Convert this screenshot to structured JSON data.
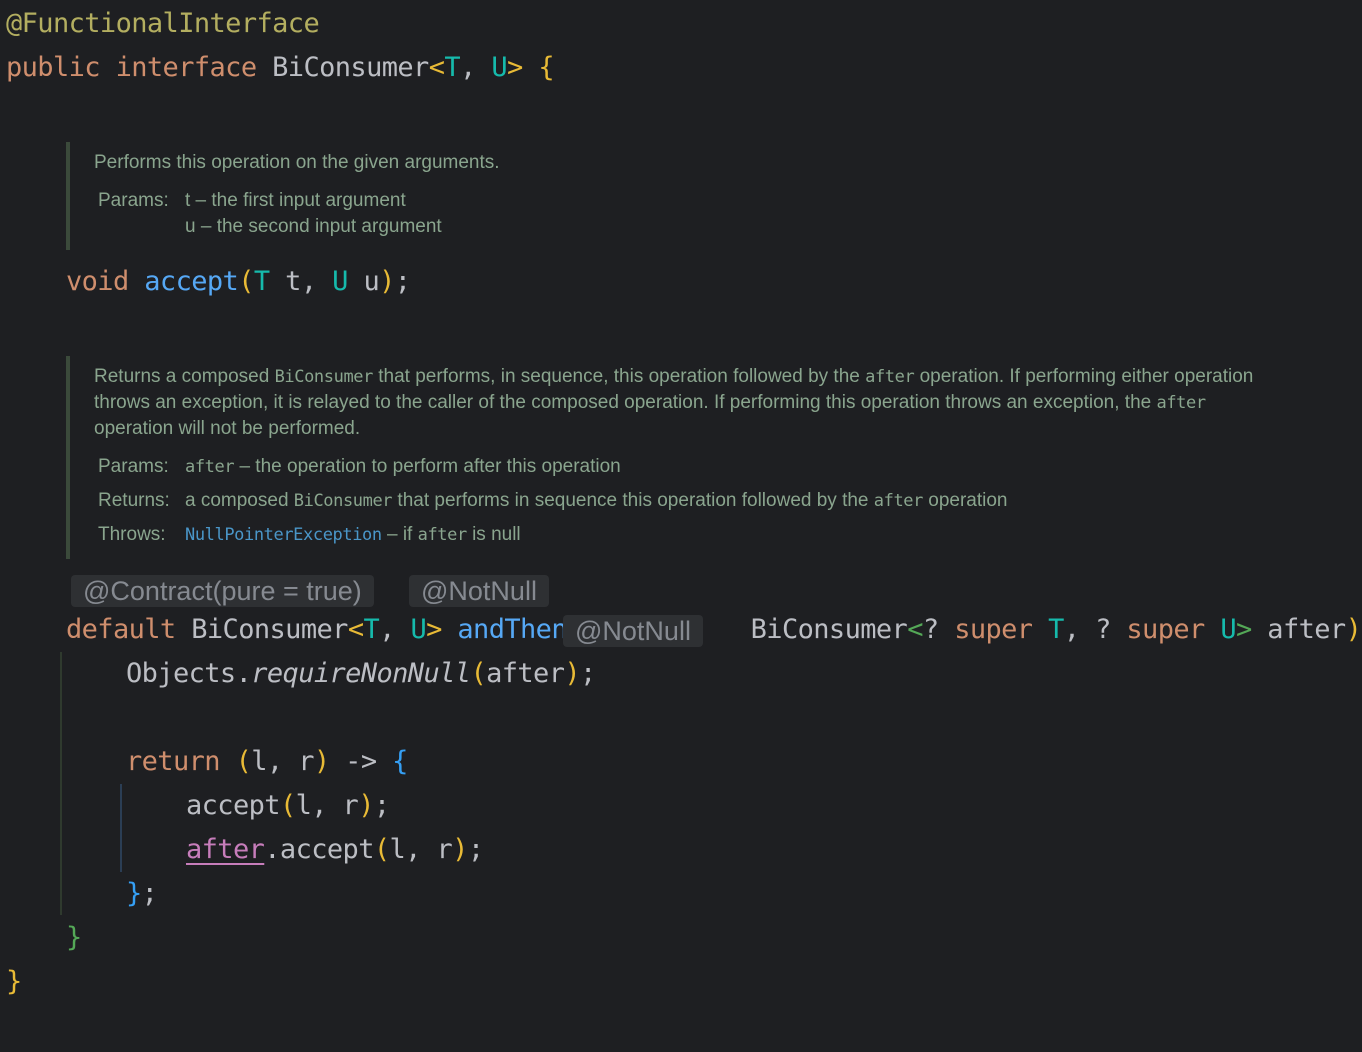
{
  "code": {
    "l1": {
      "annotation": "@FunctionalInterface"
    },
    "l2": {
      "public": "public",
      "interface": "interface",
      "name": "BiConsumer",
      "lt": "<",
      "t": "T",
      "comma": ", ",
      "u": "U",
      "gt": ">",
      "sp": " ",
      "brace": "{"
    },
    "accept_line": {
      "void": "void",
      "sp1": " ",
      "name": "accept",
      "lp": "(",
      "t": "T",
      "t_param": " t, ",
      "u": "U",
      "u_param": " u",
      "rp": ")",
      "semi": ";"
    },
    "andthen_line": {
      "default": "default",
      "ret_type": " BiConsumer",
      "lt": "<",
      "t": "T",
      "comma": ", ",
      "u": "U",
      "gt": ">",
      "sp": " ",
      "name": "andThen",
      "lp": "(",
      "param_type": "BiConsumer",
      "lt2": "<",
      "q1": "? ",
      "super1": "super",
      "sp1": " ",
      "t2": "T",
      "comma2": ", ",
      "q2": "? ",
      "super2": "super",
      "sp2": " ",
      "u2": "U",
      "gt2": ">",
      "param_name": " after",
      "rp": ")",
      "sp3": " ",
      "brace": "{"
    },
    "require_line": {
      "obj": "Objects.",
      "method": "requireNonNull",
      "lp": "(",
      "arg": "after",
      "rp": ")",
      "semi": ";"
    },
    "return_line": {
      "ret": "return",
      "sp": " ",
      "lp": "(",
      "params": "l, r",
      "rp": ")",
      "arrow": " -> ",
      "brace": "{"
    },
    "accept_call": {
      "name": "accept",
      "lp": "(",
      "args": "l, r",
      "rp": ")",
      "semi": ";"
    },
    "after_call": {
      "obj": "after",
      "method": ".accept",
      "lp": "(",
      "args": "l, r",
      "rp": ")",
      "semi": ";"
    },
    "lambda_close": {
      "brace": "}",
      "semi": ";"
    },
    "method_close": {
      "brace": "}"
    },
    "class_close": {
      "brace": "}"
    }
  },
  "doc1": {
    "description": "Performs this operation on the given arguments.",
    "params_label": "Params:",
    "param1_name": "t",
    "param1_desc": " – the first input argument",
    "param2_name": "u",
    "param2_desc": " – the second input argument"
  },
  "doc2": {
    "desc_a": "Returns a composed ",
    "desc_code1": "BiConsumer",
    "desc_b": " that performs, in sequence, this operation followed by the ",
    "desc_code2": "after",
    "desc_c": " operation. If performing either operation throws an exception, it is relayed to the caller of the composed operation. If performing this operation throws an exception, the ",
    "desc_code3": "after",
    "desc_d": " operation will not be performed.",
    "params_label": "Params:",
    "param_name": "after",
    "param_desc": " – the operation to perform after this operation",
    "returns_label": "Returns:",
    "returns_a": "a composed ",
    "returns_code1": "BiConsumer",
    "returns_b": " that performs in sequence this operation followed by the ",
    "returns_code2": "after",
    "returns_c": " operation",
    "throws_label": "Throws:",
    "throws_link": "NullPointerException",
    "throws_a": " – if ",
    "throws_code": "after",
    "throws_b": " is null"
  },
  "inlays": {
    "contract": "@Contract(pure = true)",
    "notnull_method": "@NotNull",
    "notnull_param": "@NotNull"
  },
  "colors": {
    "background": "#1e1f22",
    "keyword": "#cf8e6d",
    "annotation": "#b3ae60",
    "type_param": "#16baac",
    "method": "#56a8f5",
    "doc_text": "#8aa58e"
  }
}
